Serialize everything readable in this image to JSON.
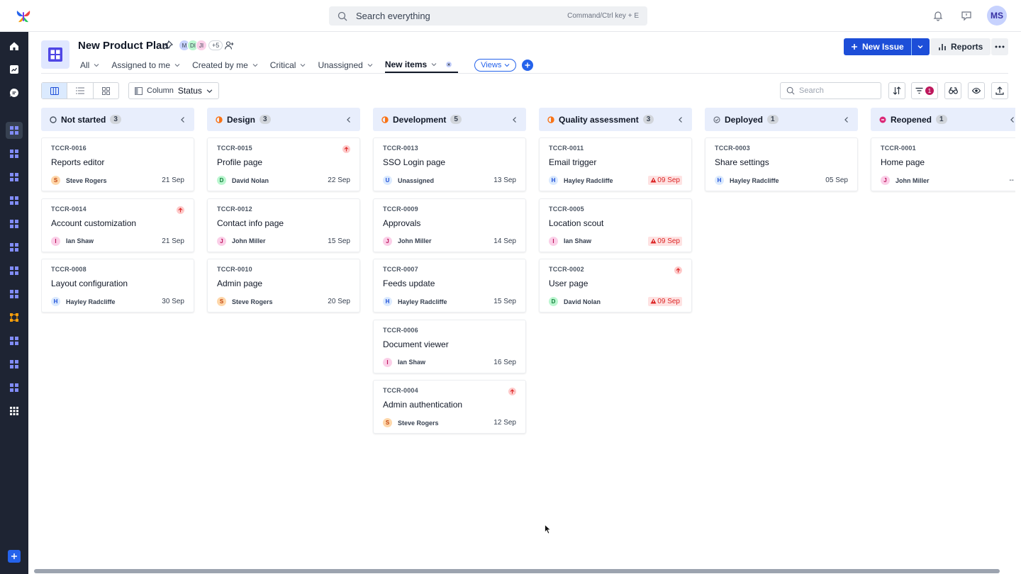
{
  "top": {
    "search_placeholder": "Search everything",
    "search_hint": "Command/Ctrl key + E",
    "avatar_initials": "MS"
  },
  "project": {
    "title": "New Product Plan",
    "members": [
      "M",
      "DI",
      "JI"
    ],
    "members_more": "+5"
  },
  "actions": {
    "new_issue": "New Issue",
    "reports": "Reports"
  },
  "tabs": [
    {
      "label": "All",
      "active": false
    },
    {
      "label": "Assigned to me",
      "active": false
    },
    {
      "label": "Created by me",
      "active": false
    },
    {
      "label": "Critical",
      "active": false
    },
    {
      "label": "Unassigned",
      "active": false
    },
    {
      "label": "New items",
      "active": true
    }
  ],
  "views_label": "Views",
  "toolbar": {
    "column_label": "Column",
    "column_value": "Status",
    "search_placeholder": "Search",
    "filter_count": "1"
  },
  "colors": {
    "accent": "#1d4ed8",
    "sidebar": "#1e2433",
    "column_header": "#e8eefc",
    "overdue": "#dc2626"
  },
  "columns": [
    {
      "title": "Not started",
      "count": "3",
      "status_color": "#4b5563",
      "status_icon": "circle-outline",
      "cards": [
        {
          "id": "TCCR-0016",
          "title": "Reports editor",
          "assignee": "Steve Rogers",
          "initial": "S",
          "av_bg": "#fed7aa",
          "av_fg": "#c2410c",
          "date": "21 Sep",
          "overdue": false,
          "priority": false
        },
        {
          "id": "TCCR-0014",
          "title": "Account customization",
          "assignee": "Ian Shaw",
          "initial": "I",
          "av_bg": "#fbcfe8",
          "av_fg": "#be185d",
          "date": "21 Sep",
          "overdue": false,
          "priority": true
        },
        {
          "id": "TCCR-0008",
          "title": "Layout configuration",
          "assignee": "Hayley Radcliffe",
          "initial": "H",
          "av_bg": "#dbeafe",
          "av_fg": "#1d4ed8",
          "date": "30 Sep",
          "overdue": false,
          "priority": false
        }
      ]
    },
    {
      "title": "Design",
      "count": "3",
      "status_color": "#f97316",
      "status_icon": "half-circle",
      "cards": [
        {
          "id": "TCCR-0015",
          "title": "Profile page",
          "assignee": "David Nolan",
          "initial": "D",
          "av_bg": "#bbf7d0",
          "av_fg": "#15803d",
          "date": "22 Sep",
          "overdue": false,
          "priority": true
        },
        {
          "id": "TCCR-0012",
          "title": "Contact info page",
          "assignee": "John Miller",
          "initial": "J",
          "av_bg": "#fbcfe8",
          "av_fg": "#be185d",
          "date": "15 Sep",
          "overdue": false,
          "priority": false
        },
        {
          "id": "TCCR-0010",
          "title": "Admin page",
          "assignee": "Steve Rogers",
          "initial": "S",
          "av_bg": "#fed7aa",
          "av_fg": "#c2410c",
          "date": "20 Sep",
          "overdue": false,
          "priority": false
        }
      ]
    },
    {
      "title": "Development",
      "count": "5",
      "status_color": "#f97316",
      "status_icon": "half-circle",
      "cards": [
        {
          "id": "TCCR-0013",
          "title": "SSO Login page",
          "assignee": "Unassigned",
          "initial": "U",
          "av_bg": "#dbeafe",
          "av_fg": "#1d4ed8",
          "date": "13 Sep",
          "overdue": false,
          "priority": false
        },
        {
          "id": "TCCR-0009",
          "title": "Approvals",
          "assignee": "John Miller",
          "initial": "J",
          "av_bg": "#fbcfe8",
          "av_fg": "#be185d",
          "date": "14 Sep",
          "overdue": false,
          "priority": false
        },
        {
          "id": "TCCR-0007",
          "title": "Feeds update",
          "assignee": "Hayley Radcliffe",
          "initial": "H",
          "av_bg": "#dbeafe",
          "av_fg": "#1d4ed8",
          "date": "15 Sep",
          "overdue": false,
          "priority": false
        },
        {
          "id": "TCCR-0006",
          "title": "Document viewer",
          "assignee": "Ian Shaw",
          "initial": "I",
          "av_bg": "#fbcfe8",
          "av_fg": "#be185d",
          "date": "16 Sep",
          "overdue": false,
          "priority": false
        },
        {
          "id": "TCCR-0004",
          "title": "Admin authentication",
          "assignee": "Steve Rogers",
          "initial": "S",
          "av_bg": "#fed7aa",
          "av_fg": "#c2410c",
          "date": "12 Sep",
          "overdue": false,
          "priority": true
        }
      ]
    },
    {
      "title": "Quality assessment",
      "count": "3",
      "status_color": "#f97316",
      "status_icon": "half-circle",
      "cards": [
        {
          "id": "TCCR-0011",
          "title": "Email trigger",
          "assignee": "Hayley Radcliffe",
          "initial": "H",
          "av_bg": "#dbeafe",
          "av_fg": "#1d4ed8",
          "date": "09 Sep",
          "overdue": true,
          "priority": false
        },
        {
          "id": "TCCR-0005",
          "title": "Location scout",
          "assignee": "Ian Shaw",
          "initial": "I",
          "av_bg": "#fbcfe8",
          "av_fg": "#be185d",
          "date": "09 Sep",
          "overdue": true,
          "priority": false
        },
        {
          "id": "TCCR-0002",
          "title": "User page",
          "assignee": "David Nolan",
          "initial": "D",
          "av_bg": "#bbf7d0",
          "av_fg": "#15803d",
          "date": "09 Sep",
          "overdue": true,
          "priority": true
        }
      ]
    },
    {
      "title": "Deployed",
      "count": "1",
      "status_color": "#6b7280",
      "status_icon": "check-circle",
      "cards": [
        {
          "id": "TCCR-0003",
          "title": "Share settings",
          "assignee": "Hayley Radcliffe",
          "initial": "H",
          "av_bg": "#dbeafe",
          "av_fg": "#1d4ed8",
          "date": "05 Sep",
          "overdue": false,
          "priority": false
        }
      ]
    },
    {
      "title": "Reopened",
      "count": "1",
      "status_color": "#db2777",
      "status_icon": "reopen-circle",
      "cards": [
        {
          "id": "TCCR-0001",
          "title": "Home page",
          "assignee": "John Miller",
          "initial": "J",
          "av_bg": "#fbcfe8",
          "av_fg": "#be185d",
          "date": "--",
          "overdue": false,
          "priority": false
        }
      ]
    }
  ]
}
